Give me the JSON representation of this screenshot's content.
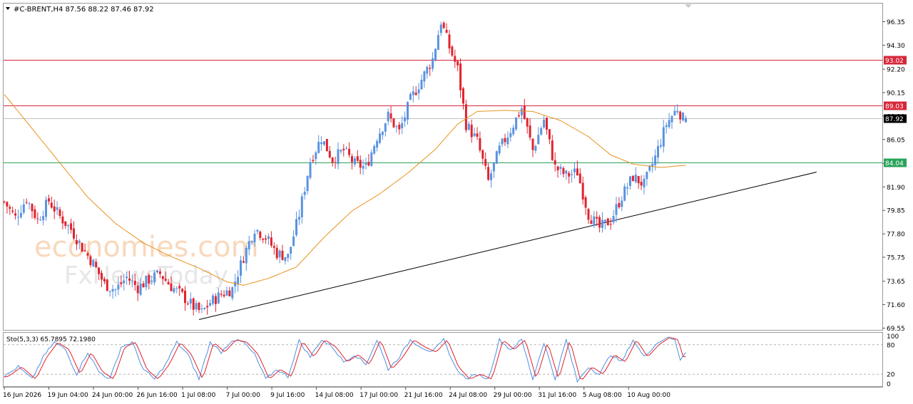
{
  "header": {
    "symbol_line": "#C-BRENT,H4  87.56 88.22 87.46 87.92"
  },
  "watermark": {
    "brand": "economies.com",
    "sub": "FxNewsToday"
  },
  "colors": {
    "bull": "#5a93e0",
    "bear": "#e0242e",
    "ma": "#e8921e",
    "resistance": "#d6263a",
    "support": "#2aa35a",
    "trendline": "#000000",
    "stoch_main": "#4f8fe0",
    "stoch_signal": "#e0242e"
  },
  "chart_data": [
    {
      "type": "candlestick",
      "title": "#C-BRENT,H4",
      "ohlc_readout": {
        "open": 87.56,
        "high": 88.22,
        "low": 87.46,
        "close": 87.92
      },
      "ylim": [
        69.55,
        97.8
      ],
      "y_ticks": [
        "96.35",
        "94.30",
        "92.20",
        "90.15",
        "88.10",
        "86.05",
        "83.95",
        "81.90",
        "79.85",
        "77.80",
        "75.75",
        "73.65",
        "71.60",
        "69.55"
      ],
      "x_ticks": [
        "16 Jun 2026",
        "19 Jun 04:00",
        "24 Jun 00:00",
        "26 Jun 16:00",
        "1 Jul 08:00",
        "7 Jul 00:00",
        "9 Jul 16:00",
        "14 Jul 08:00",
        "17 Jul 00:00",
        "21 Jul 16:00",
        "24 Jul 08:00",
        "29 Jul 00:00",
        "31 Jul 16:00",
        "5 Aug 08:00",
        "10 Aug 00:00"
      ],
      "horizontal_levels": [
        {
          "value": 93.02,
          "label": "93.02",
          "color": "#d6263a"
        },
        {
          "value": 89.03,
          "label": "89.03",
          "color": "#d6263a"
        },
        {
          "value": 87.92,
          "label": "87.92",
          "color": "#000000"
        },
        {
          "value": 84.04,
          "label": "84.04",
          "color": "#2aa35a"
        }
      ],
      "trendline": {
        "from": {
          "bar": 70,
          "value": 70.3
        },
        "to": {
          "bar": 292,
          "value": 83.2
        }
      },
      "close_path": [
        [
          0,
          80.6
        ],
        [
          4,
          79.2
        ],
        [
          8,
          80.9
        ],
        [
          12,
          79.0
        ],
        [
          16,
          80.7
        ],
        [
          20,
          79.3
        ],
        [
          24,
          78.2
        ],
        [
          28,
          76.6
        ],
        [
          32,
          75.2
        ],
        [
          36,
          73.4
        ],
        [
          40,
          72.9
        ],
        [
          44,
          74.0
        ],
        [
          48,
          73.1
        ],
        [
          52,
          73.8
        ],
        [
          56,
          74.3
        ],
        [
          60,
          73.2
        ],
        [
          64,
          72.4
        ],
        [
          68,
          71.4
        ],
        [
          71,
          70.9
        ],
        [
          74,
          71.8
        ],
        [
          78,
          72.5
        ],
        [
          82,
          73.0
        ],
        [
          86,
          75.8
        ],
        [
          90,
          78.3
        ],
        [
          94,
          77.5
        ],
        [
          98,
          76.1
        ],
        [
          102,
          75.8
        ],
        [
          106,
          79.5
        ],
        [
          110,
          84.2
        ],
        [
          114,
          86.2
        ],
        [
          118,
          84.3
        ],
        [
          122,
          85.1
        ],
        [
          126,
          83.9
        ],
        [
          130,
          83.6
        ],
        [
          134,
          86.3
        ],
        [
          138,
          88.1
        ],
        [
          142,
          86.7
        ],
        [
          146,
          89.5
        ],
        [
          150,
          91.3
        ],
        [
          154,
          93.1
        ],
        [
          157,
          96.4
        ],
        [
          160,
          94.1
        ],
        [
          163,
          92.2
        ],
        [
          166,
          87.4
        ],
        [
          170,
          85.9
        ],
        [
          174,
          82.4
        ],
        [
          178,
          85.2
        ],
        [
          182,
          86.9
        ],
        [
          186,
          88.8
        ],
        [
          190,
          85.1
        ],
        [
          194,
          87.8
        ],
        [
          198,
          83.6
        ],
        [
          202,
          82.9
        ],
        [
          206,
          83.2
        ],
        [
          210,
          79.5
        ],
        [
          214,
          78.3
        ],
        [
          218,
          79.0
        ],
        [
          222,
          81.1
        ],
        [
          226,
          82.8
        ],
        [
          230,
          82.1
        ],
        [
          234,
          84.5
        ],
        [
          238,
          87.4
        ],
        [
          242,
          88.8
        ],
        [
          245,
          87.4
        ]
      ],
      "ma_path": [
        [
          0,
          90.0
        ],
        [
          10,
          87.0
        ],
        [
          20,
          84.0
        ],
        [
          30,
          81.0
        ],
        [
          40,
          78.7
        ],
        [
          50,
          77.0
        ],
        [
          60,
          75.8
        ],
        [
          70,
          74.8
        ],
        [
          80,
          73.6
        ],
        [
          86,
          73.3
        ],
        [
          95,
          73.9
        ],
        [
          105,
          74.9
        ],
        [
          115,
          77.5
        ],
        [
          125,
          79.8
        ],
        [
          135,
          81.3
        ],
        [
          145,
          83.1
        ],
        [
          155,
          85.2
        ],
        [
          163,
          87.4
        ],
        [
          170,
          88.5
        ],
        [
          180,
          88.6
        ],
        [
          190,
          88.5
        ],
        [
          200,
          87.7
        ],
        [
          210,
          86.3
        ],
        [
          218,
          84.7
        ],
        [
          226,
          83.9
        ],
        [
          236,
          83.6
        ],
        [
          245,
          83.8
        ]
      ],
      "last_bar_ohlc": [
        87.56,
        88.22,
        87.46,
        87.92
      ]
    },
    {
      "type": "line",
      "title": "Sto(5,3,3) 65.7895 72.1980",
      "series": [
        {
          "name": "Sto main",
          "last": 65.7895
        },
        {
          "name": "Sto signal",
          "last": 72.198
        }
      ],
      "ylim": [
        0,
        100
      ],
      "y_ticks": [
        "100",
        "80",
        "20",
        "0"
      ],
      "levels": [
        80,
        20
      ],
      "peaks_troughs": [
        [
          0,
          15
        ],
        [
          5,
          35
        ],
        [
          10,
          10
        ],
        [
          14,
          55
        ],
        [
          18,
          85
        ],
        [
          22,
          70
        ],
        [
          26,
          20
        ],
        [
          30,
          65
        ],
        [
          34,
          25
        ],
        [
          38,
          10
        ],
        [
          42,
          75
        ],
        [
          46,
          85
        ],
        [
          50,
          30
        ],
        [
          54,
          10
        ],
        [
          58,
          40
        ],
        [
          62,
          85
        ],
        [
          66,
          60
        ],
        [
          70,
          10
        ],
        [
          74,
          85
        ],
        [
          78,
          65
        ],
        [
          82,
          90
        ],
        [
          86,
          85
        ],
        [
          90,
          60
        ],
        [
          94,
          10
        ],
        [
          98,
          30
        ],
        [
          102,
          15
        ],
        [
          106,
          88
        ],
        [
          110,
          55
        ],
        [
          114,
          90
        ],
        [
          118,
          75
        ],
        [
          122,
          45
        ],
        [
          126,
          60
        ],
        [
          130,
          40
        ],
        [
          134,
          90
        ],
        [
          138,
          30
        ],
        [
          142,
          55
        ],
        [
          146,
          90
        ],
        [
          150,
          75
        ],
        [
          154,
          65
        ],
        [
          158,
          90
        ],
        [
          162,
          35
        ],
        [
          166,
          10
        ],
        [
          170,
          20
        ],
        [
          174,
          10
        ],
        [
          178,
          90
        ],
        [
          182,
          70
        ],
        [
          186,
          90
        ],
        [
          190,
          10
        ],
        [
          194,
          85
        ],
        [
          198,
          10
        ],
        [
          202,
          90
        ],
        [
          206,
          5
        ],
        [
          210,
          35
        ],
        [
          214,
          20
        ],
        [
          218,
          60
        ],
        [
          222,
          45
        ],
        [
          226,
          90
        ],
        [
          230,
          55
        ],
        [
          234,
          80
        ],
        [
          238,
          95
        ],
        [
          241,
          90
        ],
        [
          243,
          50
        ],
        [
          245,
          66
        ]
      ]
    }
  ]
}
